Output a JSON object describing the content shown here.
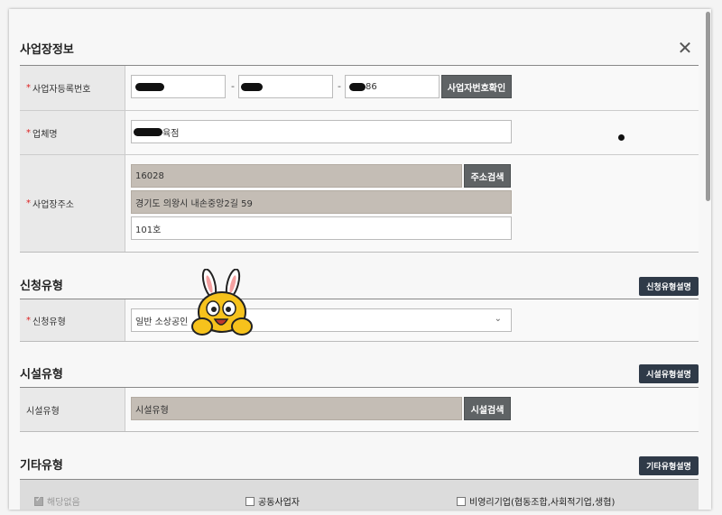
{
  "business_info": {
    "title": "사업장정보",
    "close_icon": "close-icon",
    "reg_number": {
      "label": "사업자등록번호",
      "part3_suffix": "86",
      "verify_button": "사업자번호확인"
    },
    "company_name": {
      "label": "업체명",
      "suffix": "육점"
    },
    "address": {
      "label": "사업장주소",
      "postcode": "16028",
      "search_button": "주소검색",
      "address1": "경기도 의왕시 내손중앙2길 59",
      "address2": "101호"
    }
  },
  "application_type": {
    "title": "신청유형",
    "info_button": "신청유형설명",
    "label": "신청유형",
    "selected": "일반 소상공인"
  },
  "facility_type": {
    "title": "시설유형",
    "info_button": "시설유형설명",
    "label": "시설유형",
    "placeholder": "시설유형",
    "search_button": "시설검색"
  },
  "other_type": {
    "title": "기타유형",
    "info_button": "기타유형설명",
    "options": [
      {
        "label": "해당없음",
        "checked": true
      },
      {
        "label": "공동사업자",
        "checked": false
      },
      {
        "label": "비영리기업(협동조합,사회적기업,생협)",
        "checked": false
      }
    ]
  },
  "colors": {
    "dark_button": "#2f3a48",
    "gray_button": "#5f6365",
    "required_mark": "#d22222",
    "readonly_field": "#c4bdb5"
  }
}
